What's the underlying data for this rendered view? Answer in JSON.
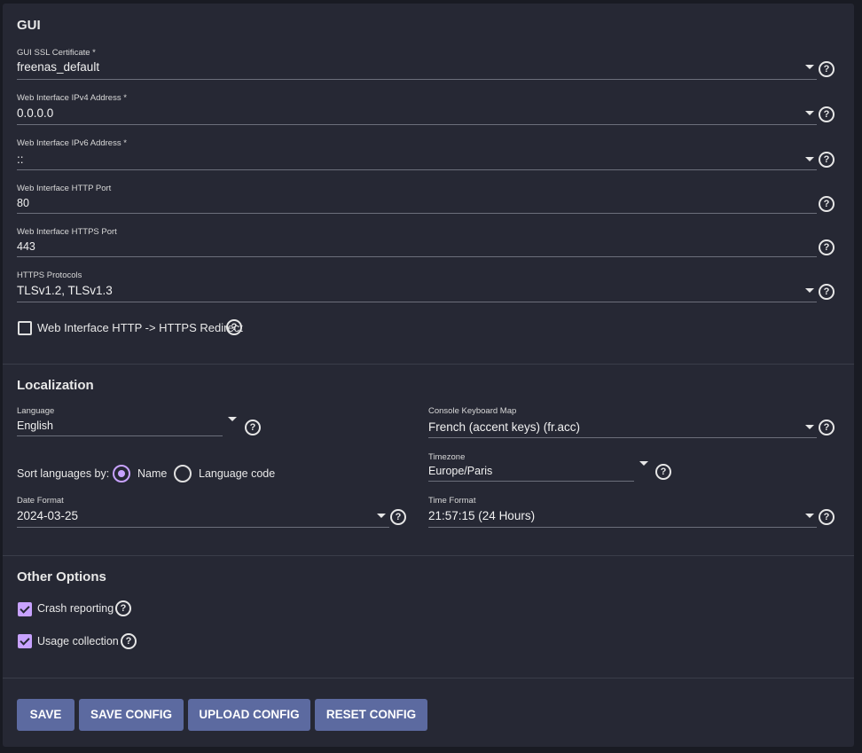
{
  "gui": {
    "title": "GUI",
    "ssl_cert": {
      "label": "GUI SSL Certificate *",
      "value": "freenas_default"
    },
    "ipv4": {
      "label": "Web Interface IPv4 Address *",
      "value": "0.0.0.0"
    },
    "ipv6": {
      "label": "Web Interface IPv6 Address *",
      "value": "::"
    },
    "http_port": {
      "label": "Web Interface HTTP Port",
      "value": "80"
    },
    "https_port": {
      "label": "Web Interface HTTPS Port",
      "value": "443"
    },
    "https_protocols": {
      "label": "HTTPS Protocols",
      "value": "TLSv1.2, TLSv1.3"
    },
    "redirect": {
      "label": "Web Interface HTTP -> HTTPS Redirect",
      "checked": false
    }
  },
  "localization": {
    "title": "Localization",
    "language": {
      "label": "Language",
      "value": "English"
    },
    "keyboard_map": {
      "label": "Console Keyboard Map",
      "value": "French (accent keys) (fr.acc)"
    },
    "sort_by": {
      "label": "Sort languages by:",
      "options": [
        "Name",
        "Language code"
      ],
      "selected": "Name"
    },
    "timezone": {
      "label": "Timezone",
      "value": "Europe/Paris"
    },
    "date_format": {
      "label": "Date Format",
      "value": "2024-03-25"
    },
    "time_format": {
      "label": "Time Format",
      "value": "21:57:15 (24 Hours)"
    }
  },
  "other": {
    "title": "Other Options",
    "crash_reporting": {
      "label": "Crash reporting",
      "checked": true
    },
    "usage_collection": {
      "label": "Usage collection",
      "checked": true
    }
  },
  "buttons": {
    "save": "SAVE",
    "save_config": "SAVE CONFIG",
    "upload_config": "UPLOAD CONFIG",
    "reset_config": "RESET CONFIG"
  },
  "icons": {
    "help": "help-circle-icon",
    "dropdown": "caret-down-icon"
  },
  "colors": {
    "background": "#191b23",
    "card": "#262834",
    "accent": "#c8a2ff",
    "button": "#5c6aa0"
  }
}
